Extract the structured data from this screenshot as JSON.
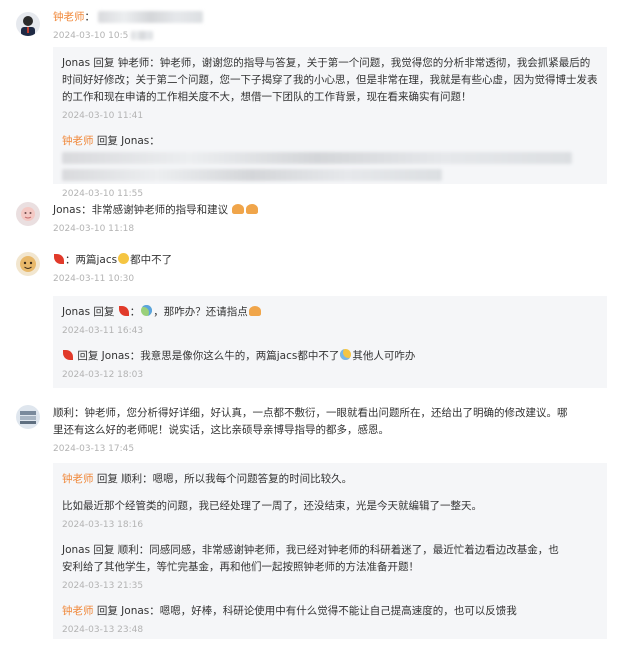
{
  "c1": {
    "name": "钟老师",
    "sep": "：",
    "time": "2024-03-10 10:5",
    "replies": [
      {
        "text": "Jonas 回复 钟老师：钟老师，谢谢您的指导与答复，关于第一个问题，我觉得您的分析非常透彻，我会抓紧最后的时间好好修改；关于第二个问题，您一下子揭穿了我的小心思，但是非常在理，我就是有些心虚，因为觉得博士发表的工作和现在申请的工作相关度不大，想借一下团队的工作背景，现在看来确实有问题！",
        "time": "2024-03-10 11:41"
      },
      {
        "name": "钟老师",
        "prefix": "回复 Jonas：",
        "time": "2024-03-10 11:55"
      }
    ]
  },
  "c2": {
    "name": "Jonas",
    "text": "：非常感谢钟老师的指导和建议",
    "time": "2024-03-10 11:18"
  },
  "c3": {
    "text": "：两篇jacs",
    "text2": "都中不了",
    "time": "2024-03-11 10:30",
    "replies": [
      {
        "prefix": "Jonas 回复",
        "text": "：",
        "text2": "，那咋办？还请指点",
        "time": "2024-03-11 16:43"
      },
      {
        "prefix": "回复 Jonas：我意思是像你这么牛的，两篇jacs都中不了",
        "text2": "其他人可咋办",
        "time": "2024-03-12 18:03"
      }
    ]
  },
  "c4": {
    "name": "顺利",
    "line1": "：钟老师，您分析得好详细，好认真，一点都不敷衍，一眼就看出问题所在，还给出了明确的修改建议。哪",
    "line2": "里还有这么好的老师呢！说实话，这比亲硕导亲博导指导的都多，感恩。",
    "time": "2024-03-13 17:45",
    "replies": [
      {
        "name": "钟老师",
        "line1": " 回复 顺利：嗯嗯，所以我每个问题答复的时间比较久。",
        "line2": "比如最近那个经管类的问题，我已经处理了一周了，还没结束，光是今天就编辑了一整天。",
        "time": "2024-03-13 18:16"
      },
      {
        "line1": "Jonas 回复 顺利：同感同感，非常感谢钟老师，我已经对钟老师的科研着迷了，最近忙着边看边改基金，也",
        "line2": "安利给了其他学生，等忙完基金，再和他们一起按照钟老师的方法准备开题！",
        "time": "2024-03-13 21:35"
      },
      {
        "name": "钟老师",
        "line1": " 回复 Jonas：嗯嗯，好棒，科研论使用中有什么觉得不能让自己提高速度的，也可以反馈我",
        "time": "2024-03-13 23:48"
      }
    ]
  }
}
